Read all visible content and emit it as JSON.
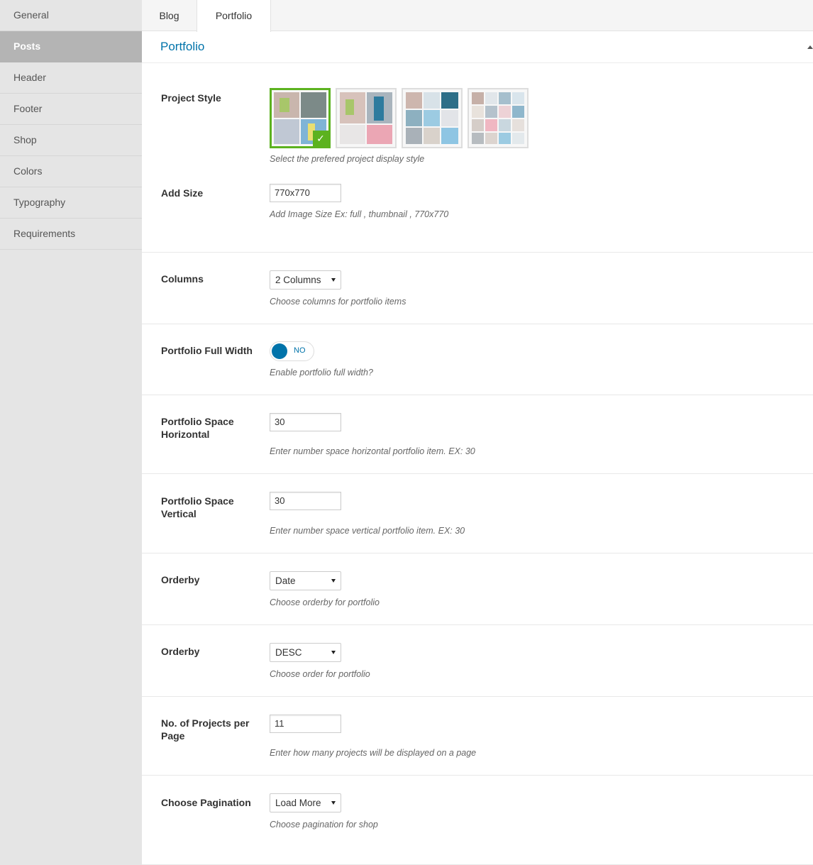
{
  "sidebar": {
    "items": [
      {
        "label": "General"
      },
      {
        "label": "Posts"
      },
      {
        "label": "Header"
      },
      {
        "label": "Footer"
      },
      {
        "label": "Shop"
      },
      {
        "label": "Colors"
      },
      {
        "label": "Typography"
      },
      {
        "label": "Requirements"
      }
    ],
    "active": "Posts"
  },
  "tabs": [
    {
      "label": "Blog"
    },
    {
      "label": "Portfolio"
    }
  ],
  "active_tab": "Portfolio",
  "section": {
    "title": "Portfolio"
  },
  "colors": {
    "accent": "#0073aa",
    "selected": "#5cb21f",
    "sidebar_active": "#b4b4b4"
  },
  "fields": {
    "project_style": {
      "label": "Project Style",
      "desc": "Select the prefered project display style",
      "options": [
        "style-1",
        "style-2",
        "style-3",
        "style-4"
      ],
      "selected": "style-1"
    },
    "add_size": {
      "label": "Add Size",
      "value": "770x770",
      "desc": "Add Image Size Ex: full , thumbnail , 770x770"
    },
    "columns": {
      "label": "Columns",
      "value": "2 Columns",
      "desc": "Choose columns for portfolio items"
    },
    "full_width": {
      "label": "Portfolio Full Width",
      "state": "NO",
      "desc": "Enable portfolio full width?"
    },
    "space_h": {
      "label": "Portfolio Space Horizontal",
      "value": "30",
      "desc": "Enter number space horizontal portfolio item. EX: 30"
    },
    "space_v": {
      "label": "Portfolio Space Vertical",
      "value": "30",
      "desc": "Enter number space vertical portfolio item. EX: 30"
    },
    "orderby": {
      "label": "Orderby",
      "value": "Date",
      "desc": "Choose orderby for portfolio"
    },
    "order": {
      "label": "Orderby",
      "value": "DESC",
      "desc": "Choose order for portfolio"
    },
    "per_page": {
      "label": "No. of Projects per Page",
      "value": "11",
      "desc": "Enter how many projects will be displayed on a page"
    },
    "pagination": {
      "label": "Choose Pagination",
      "value": "Load More",
      "desc": "Choose pagination for shop"
    }
  }
}
